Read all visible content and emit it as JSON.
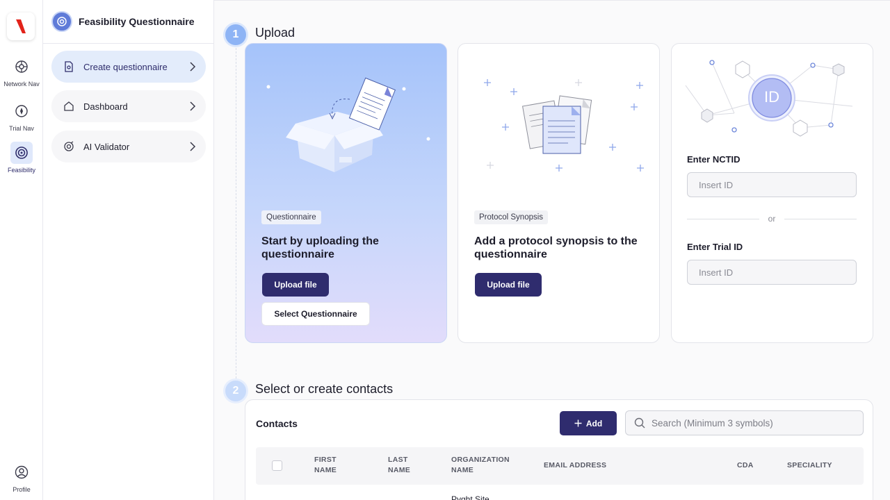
{
  "rail": {
    "items": [
      {
        "label": "Network Nav",
        "icon": "network-icon"
      },
      {
        "label": "Trial Nav",
        "icon": "trial-nav-icon"
      },
      {
        "label": "Feasibility",
        "icon": "feasibility-icon"
      }
    ],
    "profile_label": "Profile"
  },
  "sidebar": {
    "title": "Feasibility Questionnaire",
    "items": [
      {
        "label": "Create questionnaire",
        "icon": "document-icon"
      },
      {
        "label": "Dashboard",
        "icon": "home-icon"
      },
      {
        "label": "AI Validator",
        "icon": "validator-icon"
      }
    ]
  },
  "steps": [
    {
      "number": "1",
      "title": "Upload"
    },
    {
      "number": "2",
      "title": "Select or create contacts"
    }
  ],
  "cards": {
    "questionnaire": {
      "tag": "Questionnaire",
      "title": "Start by uploading the questionnaire",
      "upload_label": "Upload file",
      "select_label": "Select Questionnaire",
      "illustration_text": "Questionnaire"
    },
    "protocol": {
      "tag": "Protocol Synopsis",
      "title": "Add a protocol synopsis to the questionnaire",
      "upload_label": "Upload file"
    },
    "ids": {
      "badge": "ID",
      "nctid_label": "Enter NCTID",
      "nctid_placeholder": "Insert ID",
      "or_label": "or",
      "trial_label": "Enter Trial ID",
      "trial_placeholder": "Insert ID"
    }
  },
  "contacts": {
    "title": "Contacts",
    "add_label": "Add",
    "search_placeholder": "Search (Minimum 3 symbols)",
    "columns": [
      {
        "line1": "FIRST",
        "line2": "NAME"
      },
      {
        "line1": "LAST",
        "line2": "NAME"
      },
      {
        "line1": "ORGANIZATION",
        "line2": "NAME"
      },
      {
        "line1": "EMAIL ADDRESS",
        "line2": ""
      },
      {
        "line1": "CDA",
        "line2": ""
      },
      {
        "line1": "SPECIALITY",
        "line2": ""
      }
    ],
    "first_row_org": "Pyght Site"
  },
  "colors": {
    "accent": "#2f2c6e",
    "active_bg": "#e3ecfb",
    "step": "#8eb4f5"
  }
}
